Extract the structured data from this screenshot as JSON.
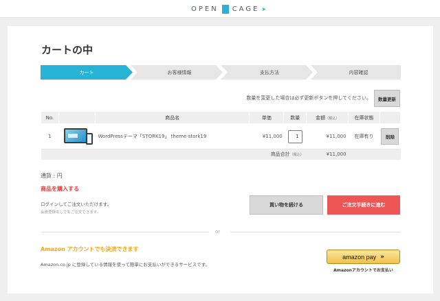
{
  "header": {
    "logo_left": "OPEN",
    "logo_right": "CAGE"
  },
  "page_title": "カートの中",
  "steps": [
    {
      "label": "カート",
      "active": true
    },
    {
      "label": "お客様情報",
      "active": false
    },
    {
      "label": "支払方法",
      "active": false
    },
    {
      "label": "内容確認",
      "active": false
    }
  ],
  "update_note": "数量を変更した場合は必ず更新ボタンを押してください。",
  "update_button": "数量更新",
  "table": {
    "headers": {
      "no": "No.",
      "name": "商品名",
      "price": "単価",
      "qty": "数量",
      "amount": "金額",
      "amount_sub": "（税込）",
      "stock": "在庫状態"
    },
    "rows": [
      {
        "no": "1",
        "name": "WordPressテーマ「STORK19」 theme-stork19",
        "price": "¥11,000",
        "qty": "1",
        "amount": "¥11,000",
        "stock": "在庫有り",
        "delete": "削除"
      }
    ],
    "total_label": "商品合計",
    "total_sub": "（税込）",
    "total_value": "¥11,000"
  },
  "currency": "通貨 : 円",
  "purchase": {
    "heading": "商品を購入する",
    "login_note": "ログインしてご注文いただけます。",
    "guest_note": "会員登録なしでもご注文できます。",
    "continue_button": "買い物を続ける",
    "checkout_button": "ご注文手続きに進む"
  },
  "or_label": "or",
  "amazon": {
    "heading": "Amazon アカウントでも決済できます",
    "note": "Amazon.co.jp に登録している情報を使って簡単にお支払いができるサービスです。",
    "button_label": "amazon pay",
    "button_arrow": "»",
    "caption": "Amazonアカウントでお支払い"
  },
  "colors": {
    "step_active": "#27b3d6",
    "step_inactive": "#e6e6e6",
    "checkout": "#ee5555",
    "amazon_heading": "#f2a41a"
  }
}
